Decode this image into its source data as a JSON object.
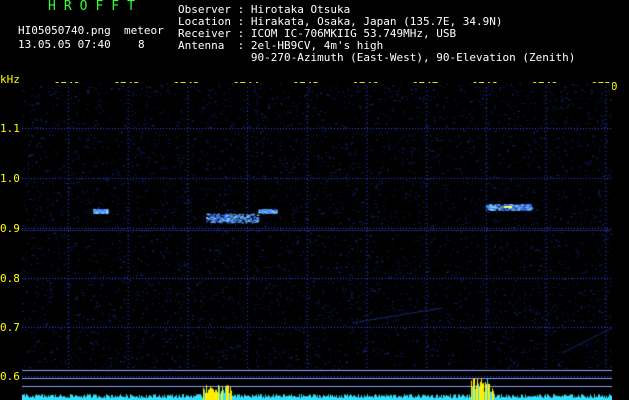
{
  "header": {
    "app_title": "HROFFT",
    "filename": "HI05050740.png",
    "datetime": "13.05.05 07:40",
    "event_type": "meteor",
    "event_count": "8"
  },
  "station_info": [
    "Observer : Hirotaka Otsuka",
    "Location : Hirakata, Osaka, Japan (135.7E, 34.9N)",
    "Receiver : ICOM IC-706MKIIG 53.749MHz, USB",
    "Antenna  : 2el-HB9CV, 4m's high",
    "           90-270-Azimuth (East-West), 90-Elevation (Zenith)"
  ],
  "axis": {
    "y_unit": "kHz",
    "x_ticks": [
      "0741",
      "0742",
      "0743",
      "0744",
      "0745",
      "0746",
      "0747",
      "0748",
      "0749",
      "0750"
    ],
    "y_ticks": [
      "1.1",
      "1.0",
      "0.9",
      "0.8",
      "0.7",
      "0.6"
    ]
  },
  "colors": {
    "background": "#000000",
    "noise": "#1a2a8c",
    "grid_dots": "#2b45ff",
    "echo": "#7fd6ff",
    "echo_core": "#ffff66",
    "baseline": "#8aa0ff",
    "amplitude": "#33e0ff",
    "amplitude_peak": "#ffee00",
    "labels": "#ffff00",
    "text": "#ffffff",
    "title": "#33ff33"
  }
}
